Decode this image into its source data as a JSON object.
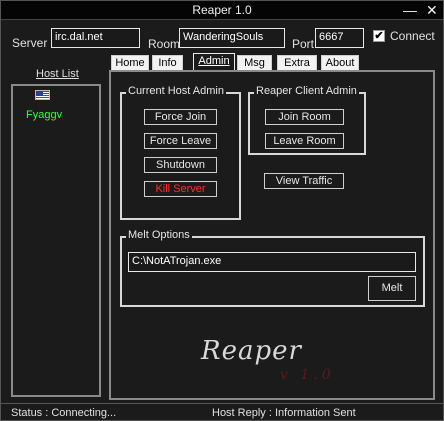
{
  "window": {
    "title": "Reaper 1.0",
    "min_glyph": "—",
    "close_glyph": "✕"
  },
  "connection": {
    "server_label": "Server",
    "server_value": "irc.dal.net",
    "room_label": "Room",
    "room_value": "WanderingSouls",
    "port_label": "Port",
    "port_value": "6667",
    "connect_label": "Connect",
    "connect_checked": true,
    "check_glyph": "✔"
  },
  "host_list": {
    "label": "Host List",
    "hosts": [
      {
        "name": "Fyaggv",
        "flag": "us-flag-icon",
        "color": "#2eff3b"
      }
    ]
  },
  "tabs": [
    {
      "label": "Home",
      "active": false
    },
    {
      "label": "Info",
      "active": false
    },
    {
      "label": "Admin",
      "active": true
    },
    {
      "label": "Msg",
      "active": false
    },
    {
      "label": "Extra",
      "active": false
    },
    {
      "label": "About",
      "active": false
    }
  ],
  "admin": {
    "host_group": {
      "title": "Current Host Admin",
      "buttons": [
        "Force Join",
        "Force Leave",
        "Shutdown",
        "Kill Server"
      ]
    },
    "client_group": {
      "title": "Reaper Client Admin",
      "buttons": [
        "Join Room",
        "Leave Room"
      ]
    },
    "view_traffic": "View Traffic",
    "melt": {
      "title": "Melt Options",
      "path": "C:\\NotATrojan.exe",
      "button": "Melt"
    }
  },
  "logo": {
    "text": "Reaper",
    "version": "v 1.0"
  },
  "status": {
    "status_text": "Status : Connecting...",
    "host_reply": "Host Reply :  Information Sent"
  },
  "colors": {
    "danger": "#ff2d2d",
    "host_name": "#2eff3b",
    "logo_version": "#5b1c1c"
  }
}
